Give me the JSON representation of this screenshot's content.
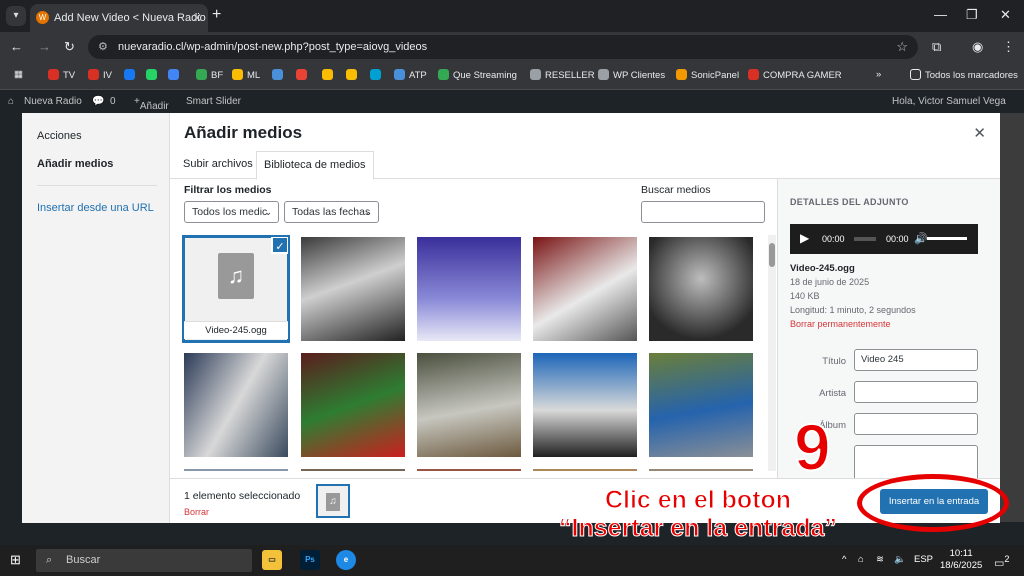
{
  "browser": {
    "tab_title": "Add New Video < Nueva Radio",
    "url": "nuevaradio.cl/wp-admin/post-new.php?post_type=aiovg_videos"
  },
  "bookmarks": [
    {
      "label": "TV",
      "color": "#d93025"
    },
    {
      "label": "IV",
      "color": "#d93025"
    },
    {
      "label": "",
      "color": "#1877f2"
    },
    {
      "label": "",
      "color": "#25d366"
    },
    {
      "label": "",
      "color": "#4285f4"
    },
    {
      "label": "BF",
      "color": "#34a853"
    },
    {
      "label": "ML",
      "color": "#fbbc04"
    },
    {
      "label": "",
      "color": "#4a90d9"
    },
    {
      "label": "",
      "color": "#ea4335"
    },
    {
      "label": "",
      "color": "#fbbc04"
    },
    {
      "label": "",
      "color": "#fbbc04"
    },
    {
      "label": "",
      "color": "#00a0d2"
    },
    {
      "label": "ATP",
      "color": "#4a90d9"
    },
    {
      "label": "Que Streaming",
      "color": "#34a853"
    },
    {
      "label": "RESELLER",
      "color": "#9aa0a6"
    },
    {
      "label": "WP Clientes",
      "color": "#9aa0a6"
    },
    {
      "label": "SonicPanel",
      "color": "#f29900"
    },
    {
      "label": "COMPRA GAMER",
      "color": "#d93025"
    }
  ],
  "bookmarks_all": "Todos los marcadores",
  "wp": {
    "site": "Nueva Radio",
    "comments": "0",
    "new": "Añadir",
    "slider": "Smart Slider",
    "greeting": "Hola, Victor Samuel Vega"
  },
  "modal": {
    "menu": {
      "actions": "Acciones",
      "add_media": "Añadir medios",
      "insert_url": "Insertar desde una URL"
    },
    "title": "Añadir medios",
    "tabs": [
      "Subir archivos",
      "Biblioteca de medios"
    ],
    "filter_label": "Filtrar los medios",
    "filter_type": "Todos los medic",
    "filter_date": "Todas las fechas",
    "search_label": "Buscar medios",
    "selected_file": "Video-245.ogg",
    "details": {
      "header": "DETALLES DEL ADJUNTO",
      "time_cur": "00:00",
      "time_total": "00:00",
      "filename": "Video-245.ogg",
      "date": "18 de junio de 2025",
      "size": "140 KB",
      "length": "Longitud: 1 minuto, 2 segundos",
      "delete": "Borrar permanentemente",
      "f_title": "Título",
      "f_title_val": "Video 245",
      "f_artist": "Artista",
      "f_album": "Álbum"
    },
    "footer": {
      "count": "1 elemento seleccionado",
      "clear": "Borrar",
      "insert": "Insertar en la entrada"
    }
  },
  "annotation": {
    "step": "9",
    "line1": "Clic en el boton",
    "line2": "“Insertar en la entrada”"
  },
  "taskbar": {
    "search": "Buscar",
    "lang": "ESP",
    "time": "10:11",
    "date": "18/6/2025",
    "notif": "2"
  }
}
